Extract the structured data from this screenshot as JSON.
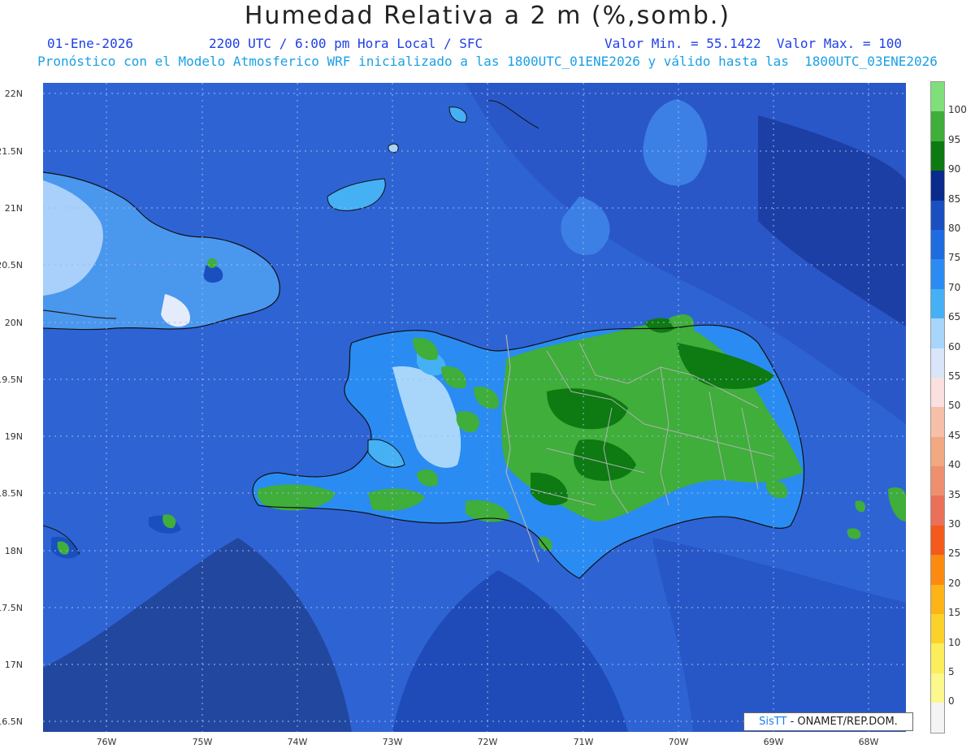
{
  "title": "Humedad Relativa a 2 m (%,somb.)",
  "header": {
    "date": "01-Ene-2026",
    "time_info": "2200 UTC / 6:00 pm Hora Local / SFC",
    "min_max": "Valor Min. = 55.1422  Valor Max. = 100"
  },
  "subtitle": "Pronóstico con el Modelo Atmosferico WRF inicializado a las 1800UTC_01ENE2026 y válido hasta las  1800UTC_03ENE2026",
  "map": {
    "lat_labels": [
      "22N",
      "21.5N",
      "21N",
      "20.5N",
      "20N",
      "19.5N",
      "19N",
      "18.5N",
      "18N",
      "17.5N",
      "17N",
      "16.5N"
    ],
    "lon_labels": [
      "76W",
      "75W",
      "74W",
      "73W",
      "72W",
      "71W",
      "70W",
      "69W",
      "68W"
    ]
  },
  "colorbar": {
    "labels": [
      "100",
      "95",
      "90",
      "85",
      "80",
      "75",
      "70",
      "65",
      "60",
      "55",
      "50",
      "45",
      "40",
      "35",
      "30",
      "25",
      "20",
      "15",
      "10",
      "5",
      "0"
    ],
    "colors": [
      "#7fe07a",
      "#3fae3a",
      "#0d7a12",
      "#0a2a8c",
      "#1a4fc0",
      "#1f6be0",
      "#2a8cf2",
      "#46b0f5",
      "#a8d6fb",
      "#d9e6fa",
      "#fbe0e0",
      "#f6c0a8",
      "#f2a880",
      "#ee8f70",
      "#ea7058",
      "#f45a1c",
      "#fc8a10",
      "#fcb416",
      "#fcd22a",
      "#fcee5a",
      "#fcf88c",
      "#f4f4f4"
    ]
  },
  "credit": {
    "brand": "SisTT",
    "text": " - ONAMET/REP.DOM."
  }
}
